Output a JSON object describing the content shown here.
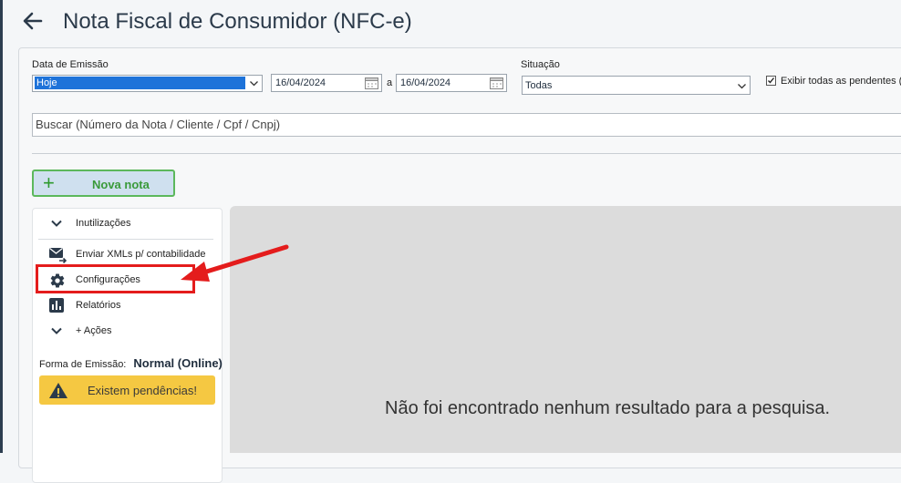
{
  "header": {
    "title": "Nota Fiscal de Consumidor (NFC-e)",
    "back_icon": "arrow-left-icon"
  },
  "filters": {
    "date_label": "Data de Emissão",
    "period_value": "Hoje",
    "date_from": "16/04/2024",
    "date_sep": "a",
    "date_to": "16/04/2024",
    "situacao_label": "Situação",
    "situacao_value": "Todas",
    "show_pending_label": "Exibir todas as pendentes (i",
    "show_pending_checked": true
  },
  "search": {
    "placeholder": "Buscar (Número da Nota / Cliente / Cpf / Cnpj)"
  },
  "actions": {
    "new_note_label": "Nova nota"
  },
  "sidebar": {
    "items": [
      {
        "label": "Inutilizações",
        "icon": "chevron-down-icon"
      },
      {
        "label": "Enviar XMLs p/ contabilidade",
        "icon": "mail-send-icon"
      },
      {
        "label": "Configurações",
        "icon": "gear-icon"
      },
      {
        "label": "Relatórios",
        "icon": "bar-chart-icon"
      },
      {
        "label": "+ Ações",
        "icon": "chevron-down-icon"
      }
    ],
    "forma_label": "Forma de Emissão:",
    "forma_value": "Normal (Online)",
    "pending_text": "Existem pendências!"
  },
  "results": {
    "empty_message": "Não foi encontrado nenhum resultado para a pesquisa."
  },
  "colors": {
    "accent_green": "#5cb85c",
    "highlight_red": "#e41c1c",
    "warning_yellow": "#f5c842",
    "select_blue": "#1e73d9"
  }
}
